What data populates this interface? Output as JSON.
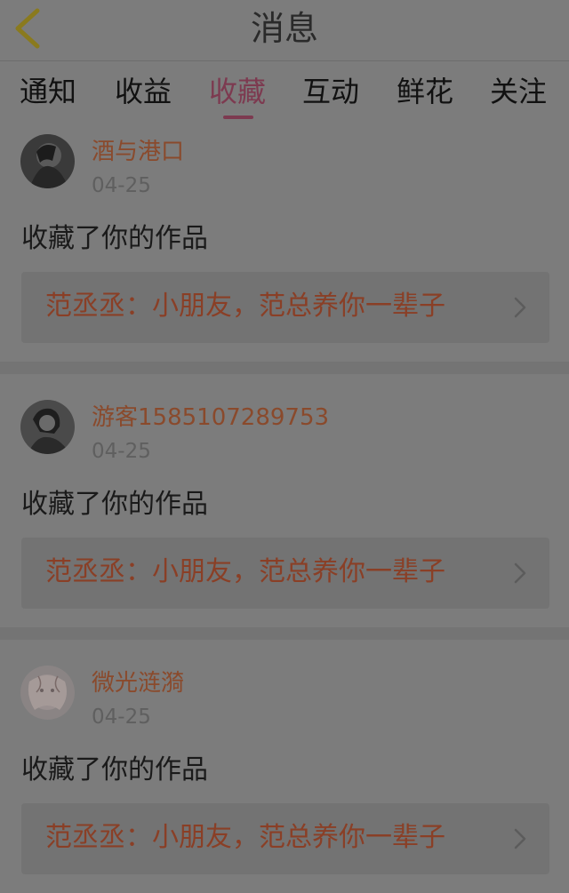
{
  "header": {
    "title": "消息",
    "back_icon": "chevron-left-icon"
  },
  "tabs": [
    {
      "label": "通知",
      "active": false
    },
    {
      "label": "收益",
      "active": false
    },
    {
      "label": "收藏",
      "active": true
    },
    {
      "label": "互动",
      "active": false
    },
    {
      "label": "鲜花",
      "active": false
    },
    {
      "label": "关注",
      "active": false
    }
  ],
  "notifications": [
    {
      "username": "酒与港口",
      "date": "04-25",
      "action": "收藏了你的作品",
      "work_title": "范丞丞：小朋友，范总养你一辈子"
    },
    {
      "username": "游客1585107289753",
      "date": "04-25",
      "action": "收藏了你的作品",
      "work_title": "范丞丞：小朋友，范总养你一辈子"
    },
    {
      "username": "微光涟漪",
      "date": "04-25",
      "action": "收藏了你的作品",
      "work_title": "范丞丞：小朋友，范总养你一辈子"
    }
  ],
  "colors": {
    "background": "#7c7c7c",
    "accent": "#7d3a50",
    "username": "#8a4a2c",
    "work_title": "#8a3f26",
    "back_icon": "#8a7a1e"
  }
}
